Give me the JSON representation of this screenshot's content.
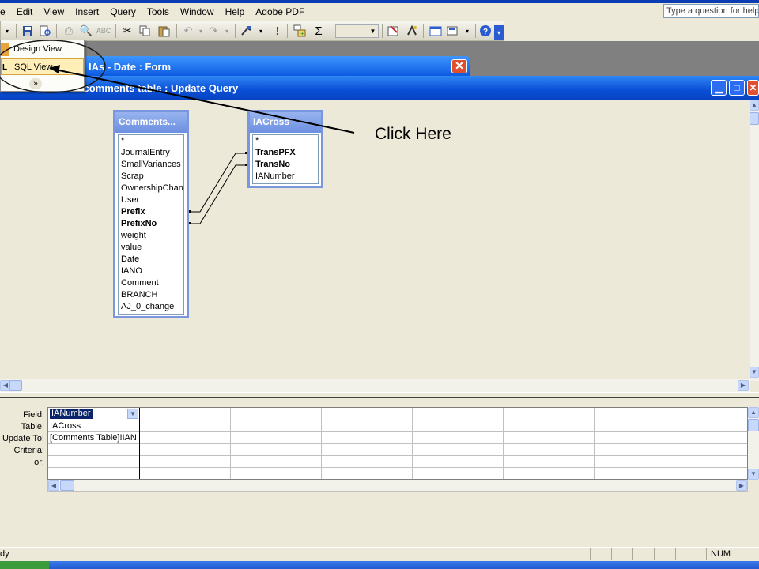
{
  "menu": [
    "e",
    "Edit",
    "View",
    "Insert",
    "Query",
    "Tools",
    "Window",
    "Help",
    "Adobe PDF"
  ],
  "help_placeholder": "Type a question for help",
  "form_window_title": "IAs - Date : Form",
  "query_window_title": "...no in comments table : Update Query",
  "view_menu": {
    "design": "Design View",
    "sql": "SQL View",
    "sql_icon_letter": "L",
    "more": "»"
  },
  "callout": "Click Here",
  "tables": {
    "comments": {
      "title": "Comments...",
      "fields": [
        "*",
        "JournalEntry",
        "SmallVariances",
        "Scrap",
        "OwnershipChang",
        "User",
        "Prefix",
        "PrefixNo",
        "weight",
        "value",
        "Date",
        "IANO",
        "Comment",
        "BRANCH",
        "AJ_0_change"
      ],
      "key_fields": [
        "Prefix",
        "PrefixNo"
      ]
    },
    "iacross": {
      "title": "IACross",
      "fields": [
        "*",
        "TransPFX",
        "TransNo",
        "IANumber"
      ],
      "key_fields": [
        "TransPFX",
        "TransNo"
      ]
    }
  },
  "grid": {
    "row_labels": [
      "Field:",
      "Table:",
      "Update To:",
      "Criteria:",
      "or:"
    ],
    "column1": {
      "field": "IANumber",
      "table": "IACross",
      "update_to": "[Comments Table]!IAN"
    }
  },
  "status": {
    "left": "dy",
    "num": "NUM"
  },
  "icons": {
    "save": "save-icon",
    "sigma": "sum-icon",
    "help": "help-icon"
  }
}
